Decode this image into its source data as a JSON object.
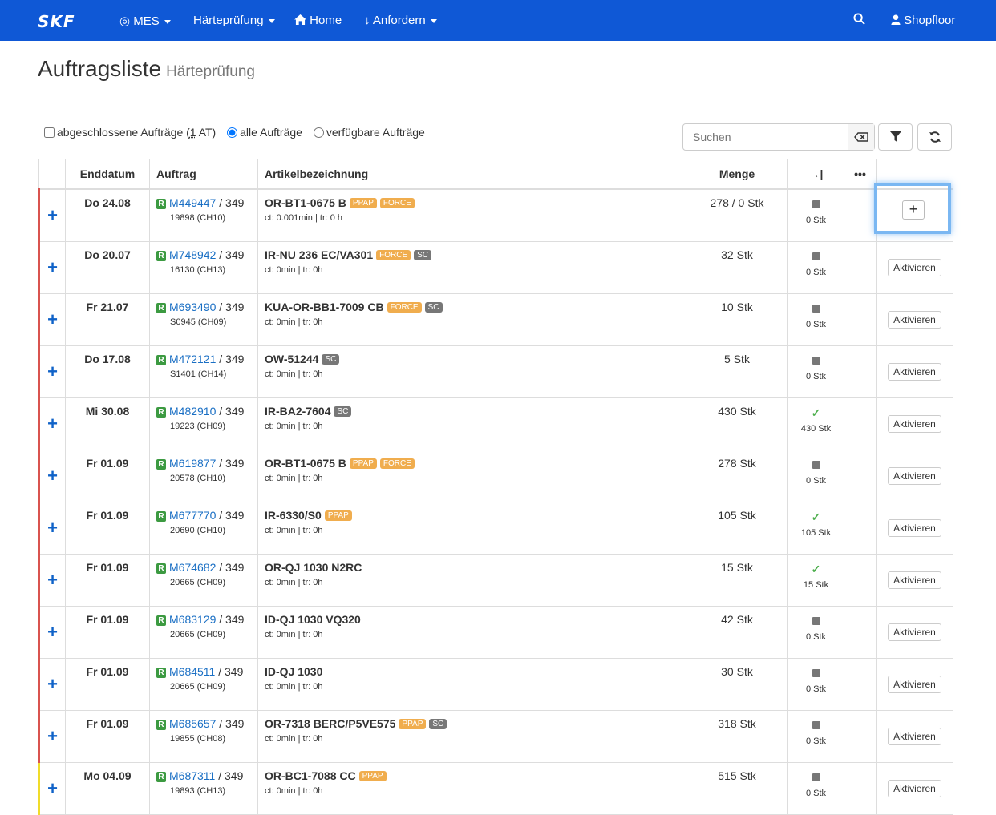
{
  "nav": {
    "brand": "SKF",
    "mes": "MES",
    "haerte": "Härteprüfung",
    "home": "Home",
    "anfordern": "Anfordern",
    "user": "Shopfloor"
  },
  "page": {
    "title": "Auftragsliste",
    "subtitle": "Härteprüfung"
  },
  "filters": {
    "closed_pre": "abgeschlossene Aufträge (",
    "closed_link": "1",
    "closed_post": " AT)",
    "all": "alle Aufträge",
    "available": "verfügbare Aufträge",
    "selected": "all"
  },
  "search": {
    "placeholder": "Suchen"
  },
  "table": {
    "headers": [
      "Enddatum",
      "Auftrag",
      "Artikelbezeichnung",
      "Menge",
      "→|",
      "•••"
    ],
    "rows": [
      {
        "date": "Do 24.08",
        "order": "M449447",
        "suffix": " / 349",
        "sub": "19898 (CH10)",
        "article": "OR-BT1-0675 B",
        "badges": [
          "PPAP",
          "FORCE"
        ],
        "ct": "ct: 0.001min | tr: 0 h",
        "qty": "278 / 0 Stk",
        "status": "square",
        "status_label": "0 Stk",
        "action": "+",
        "marker": "red"
      },
      {
        "date": "Do 20.07",
        "order": "M748942",
        "suffix": " / 349",
        "sub": "16130 (CH13)",
        "article": "IR-NU 236 EC/VA301",
        "badges": [
          "FORCE",
          "SC"
        ],
        "ct": "ct: 0min | tr: 0h",
        "qty": "32 Stk",
        "status": "square",
        "status_label": "0 Stk",
        "action": "Aktivieren",
        "marker": "red"
      },
      {
        "date": "Fr 21.07",
        "order": "M693490",
        "suffix": " / 349",
        "sub": "S0945 (CH09)",
        "article": "KUA-OR-BB1-7009 CB",
        "badges": [
          "FORCE",
          "SC"
        ],
        "ct": "ct: 0min | tr: 0h",
        "qty": "10 Stk",
        "status": "square",
        "status_label": "0 Stk",
        "action": "Aktivieren",
        "marker": "red"
      },
      {
        "date": "Do 17.08",
        "order": "M472121",
        "suffix": " / 349",
        "sub": "S1401 (CH14)",
        "article": "OW-51244",
        "badges": [
          "SC"
        ],
        "ct": "ct: 0min | tr: 0h",
        "qty": "5 Stk",
        "status": "square",
        "status_label": "0 Stk",
        "action": "Aktivieren",
        "marker": "red"
      },
      {
        "date": "Mi 30.08",
        "order": "M482910",
        "suffix": " / 349",
        "sub": "19223 (CH09)",
        "article": "IR-BA2-7604",
        "badges": [
          "SC"
        ],
        "ct": "ct: 0min | tr: 0h",
        "qty": "430 Stk",
        "status": "check",
        "status_label": "430 Stk",
        "action": "Aktivieren",
        "marker": "red"
      },
      {
        "date": "Fr 01.09",
        "order": "M619877",
        "suffix": " / 349",
        "sub": "20578 (CH10)",
        "article": "OR-BT1-0675 B",
        "badges": [
          "PPAP",
          "FORCE"
        ],
        "ct": "ct: 0min | tr: 0h",
        "qty": "278 Stk",
        "status": "square",
        "status_label": "0 Stk",
        "action": "Aktivieren",
        "marker": "red"
      },
      {
        "date": "Fr 01.09",
        "order": "M677770",
        "suffix": " / 349",
        "sub": "20690 (CH10)",
        "article": "IR-6330/S0",
        "badges": [
          "PPAP"
        ],
        "ct": "ct: 0min | tr: 0h",
        "qty": "105 Stk",
        "status": "check",
        "status_label": "105 Stk",
        "action": "Aktivieren",
        "marker": "red"
      },
      {
        "date": "Fr 01.09",
        "order": "M674682",
        "suffix": " / 349",
        "sub": "20665 (CH09)",
        "article": "OR-QJ 1030 N2RC",
        "badges": [],
        "ct": "ct: 0min | tr: 0h",
        "qty": "15 Stk",
        "status": "check",
        "status_label": "15 Stk",
        "action": "Aktivieren",
        "marker": "red"
      },
      {
        "date": "Fr 01.09",
        "order": "M683129",
        "suffix": " / 349",
        "sub": "20665 (CH09)",
        "article": "ID-QJ 1030 VQ320",
        "badges": [],
        "ct": "ct: 0min | tr: 0h",
        "qty": "42 Stk",
        "status": "square",
        "status_label": "0 Stk",
        "action": "Aktivieren",
        "marker": "red"
      },
      {
        "date": "Fr 01.09",
        "order": "M684511",
        "suffix": " / 349",
        "sub": "20665 (CH09)",
        "article": "ID-QJ 1030",
        "badges": [],
        "ct": "ct: 0min | tr: 0h",
        "qty": "30 Stk",
        "status": "square",
        "status_label": "0 Stk",
        "action": "Aktivieren",
        "marker": "red"
      },
      {
        "date": "Fr 01.09",
        "order": "M685657",
        "suffix": " / 349",
        "sub": "19855 (CH08)",
        "article": "OR-7318 BERC/P5VE575",
        "badges": [
          "PPAP",
          "SC"
        ],
        "ct": "ct: 0min | tr: 0h",
        "qty": "318 Stk",
        "status": "square",
        "status_label": "0 Stk",
        "action": "Aktivieren",
        "marker": "red"
      },
      {
        "date": "Mo 04.09",
        "order": "M687311",
        "suffix": " / 349",
        "sub": "19893 (CH13)",
        "article": "OR-BC1-7088 CC",
        "badges": [
          "PPAP"
        ],
        "ct": "ct: 0min | tr: 0h",
        "qty": "515 Stk",
        "status": "square",
        "status_label": "0 Stk",
        "action": "Aktivieren",
        "marker": "yellow"
      }
    ]
  },
  "colors": {
    "navbar": "#0f58d6",
    "link": "#1a6fc4",
    "badge_orange": "#f0ad4e",
    "badge_gray": "#777777",
    "marker_red": "#d9534f",
    "marker_yellow": "#f0dc2a",
    "check": "#4cae4c"
  },
  "icons": {
    "search": "search-icon",
    "user": "user-icon",
    "home": "home-icon",
    "filter": "filter-icon",
    "refresh": "refresh-icon",
    "clear": "backspace-icon"
  }
}
